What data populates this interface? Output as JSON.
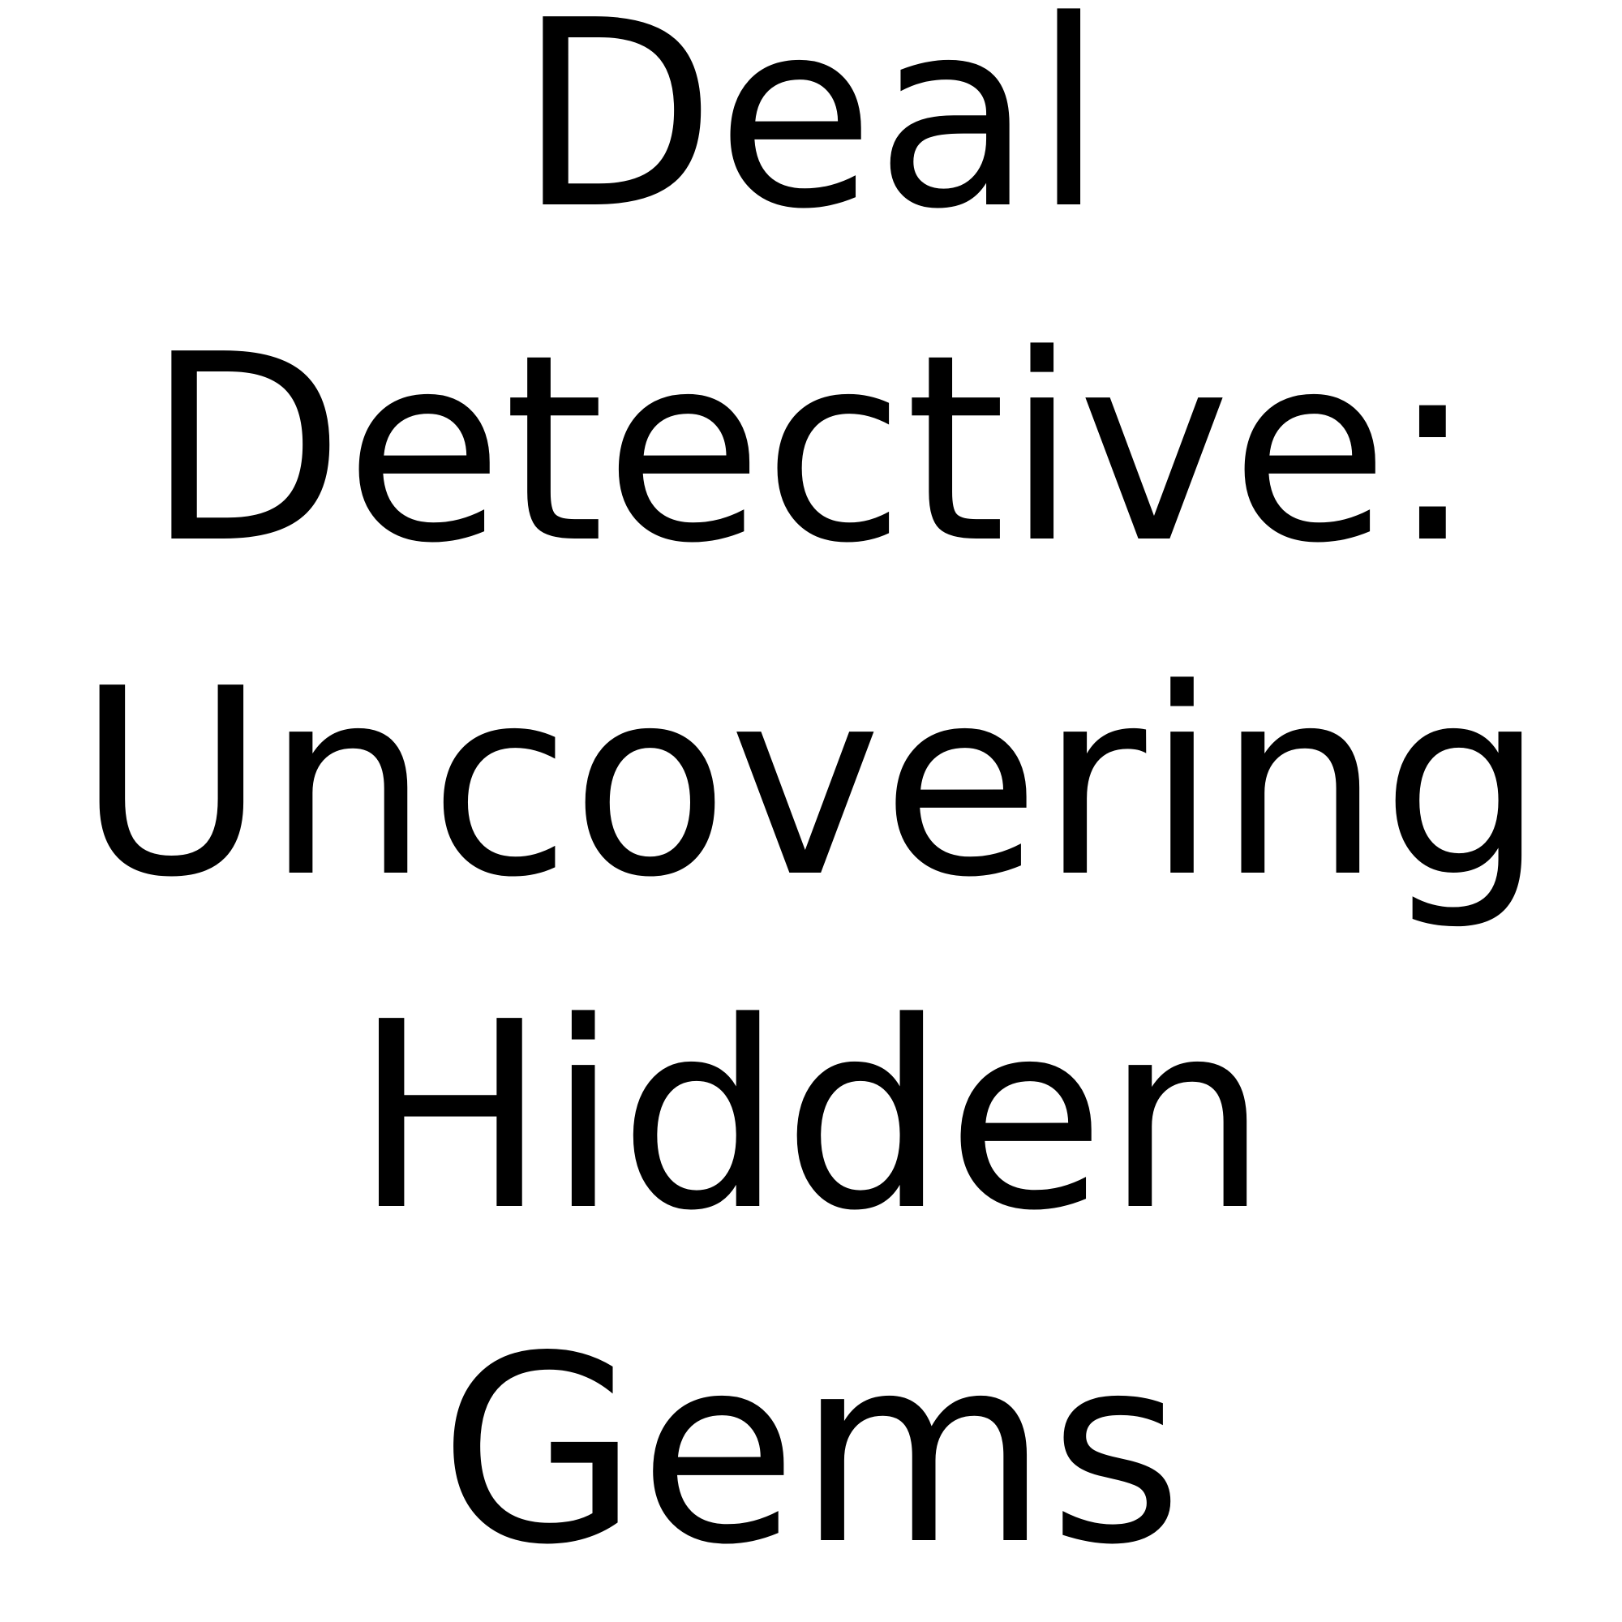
{
  "title": {
    "lines": [
      "Deal",
      "Detective:",
      "Uncovering",
      "Hidden",
      "Gems"
    ]
  }
}
